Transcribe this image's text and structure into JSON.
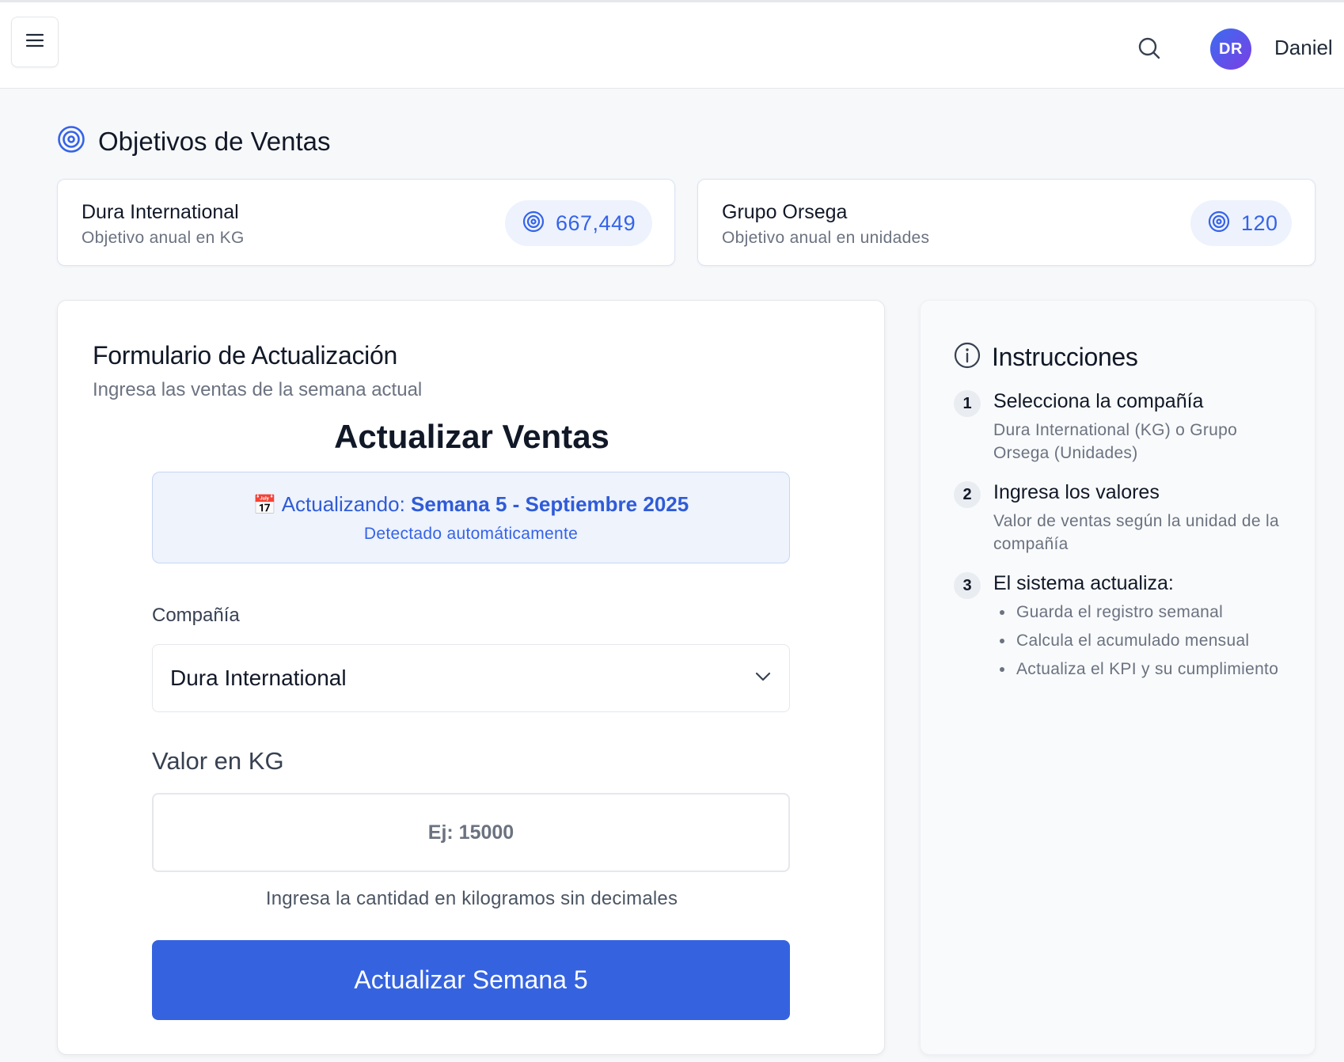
{
  "header": {
    "menu_icon": "hamburger-menu-icon",
    "search_icon": "search-icon",
    "avatar_initials": "DR",
    "user_name": "Daniel"
  },
  "page": {
    "title": "Objetivos de Ventas",
    "title_icon": "target-icon"
  },
  "kpis": [
    {
      "company": "Dura International",
      "subtitle": "Objetivo anual en KG",
      "value": "667,449",
      "icon": "target-icon"
    },
    {
      "company": "Grupo Orsega",
      "subtitle": "Objetivo anual en unidades",
      "value": "120",
      "icon": "target-icon"
    }
  ],
  "form": {
    "title": "Formulario de Actualización",
    "subtitle": "Ingresa las ventas de la semana actual",
    "heading": "Actualizar Ventas",
    "week_box": {
      "prefix": "Actualizando: ",
      "week": "Semana 5 - Septiembre 2025",
      "detected": "Detectado automáticamente",
      "icon": "calendar-icon"
    },
    "company_label": "Compañía",
    "company_value": "Dura International",
    "value_label": "Valor en KG",
    "value_placeholder": "Ej: 15000",
    "value_current": "",
    "help_text": "Ingresa la cantidad en kilogramos sin decimales",
    "submit_label": "Actualizar Semana 5"
  },
  "instructions": {
    "title": "Instrucciones",
    "icon": "info-icon",
    "steps": [
      {
        "num": "1",
        "title": "Selecciona la compañía",
        "desc": "Dura International (KG) o Grupo Orsega (Unidades)"
      },
      {
        "num": "2",
        "title": "Ingresa los valores",
        "desc": "Valor de ventas según la unidad de la compañía"
      },
      {
        "num": "3",
        "title": "El sistema actualiza:",
        "bullets": [
          "Guarda el registro semanal",
          "Calcula el acumulado mensual",
          "Actualiza el KPI y su cumplimiento"
        ]
      }
    ]
  },
  "colors": {
    "accent": "#3563e9",
    "button": "#3563e0",
    "avatar_from": "#3b6cf0",
    "avatar_to": "#7b3fe4"
  }
}
